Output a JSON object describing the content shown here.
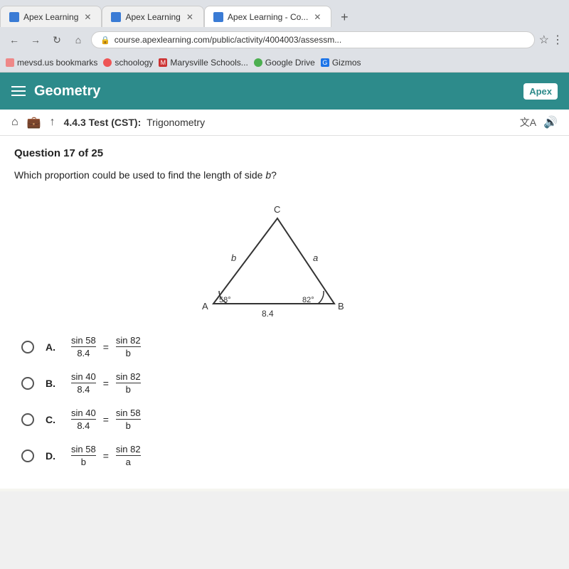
{
  "browser": {
    "tabs": [
      {
        "id": "tab1",
        "title": "Apex Learning",
        "active": false,
        "icon_color": "#3a7bd5"
      },
      {
        "id": "tab2",
        "title": "Apex Learning",
        "active": false,
        "icon_color": "#3a7bd5"
      },
      {
        "id": "tab3",
        "title": "Apex Learning - Co...",
        "active": true,
        "icon_color": "#3a7bd5"
      }
    ],
    "address": "course.apexlearning.com/public/activity/4004003/assessm...",
    "bookmarks": [
      {
        "label": "mevsd.us bookmarks",
        "icon_color": "#e8a"
      },
      {
        "label": "schoology",
        "icon_color": "#e55"
      },
      {
        "label": "Marysville Schools...",
        "icon_color": "#c33"
      },
      {
        "label": "Google Drive",
        "icon_color": "#4caf50"
      },
      {
        "label": "Gizmos",
        "icon_color": "#1a73e8"
      }
    ]
  },
  "app": {
    "title": "Geometry",
    "logo": "Apex",
    "test_prefix": "4.4.3 Test (CST):",
    "test_name": "Trigonometry"
  },
  "question": {
    "number": "Question 17 of 25",
    "text": "Which proportion could be used to find the length of side ",
    "variable": "b",
    "text_suffix": "?",
    "triangle": {
      "vertex_a": "A",
      "vertex_b": "B",
      "vertex_c": "C",
      "side_b_label": "b",
      "side_a_label": "a",
      "angle_a": "58°",
      "angle_b": "82°",
      "base_length": "8.4"
    }
  },
  "answers": [
    {
      "id": "A",
      "numerator1": "sin 58",
      "denominator1": "8.4",
      "numerator2": "sin 82",
      "denominator2": "b"
    },
    {
      "id": "B",
      "numerator1": "sin 40",
      "denominator1": "8.4",
      "numerator2": "sin 82",
      "denominator2": "b"
    },
    {
      "id": "C",
      "numerator1": "sin 40",
      "denominator1": "8.4",
      "numerator2": "sin 58",
      "denominator2": "b"
    },
    {
      "id": "D",
      "numerator1": "sin 58",
      "denominator1": "b",
      "numerator2": "sin 82",
      "denominator2": "a"
    }
  ],
  "icons": {
    "hamburger": "☰",
    "back": "←",
    "forward": "→",
    "reload": "↺",
    "home": "⌂",
    "lock": "🔒",
    "translate": "文A",
    "audio": "🔊",
    "home_btn": "⌂",
    "briefcase": "💼",
    "upload": "↑"
  }
}
